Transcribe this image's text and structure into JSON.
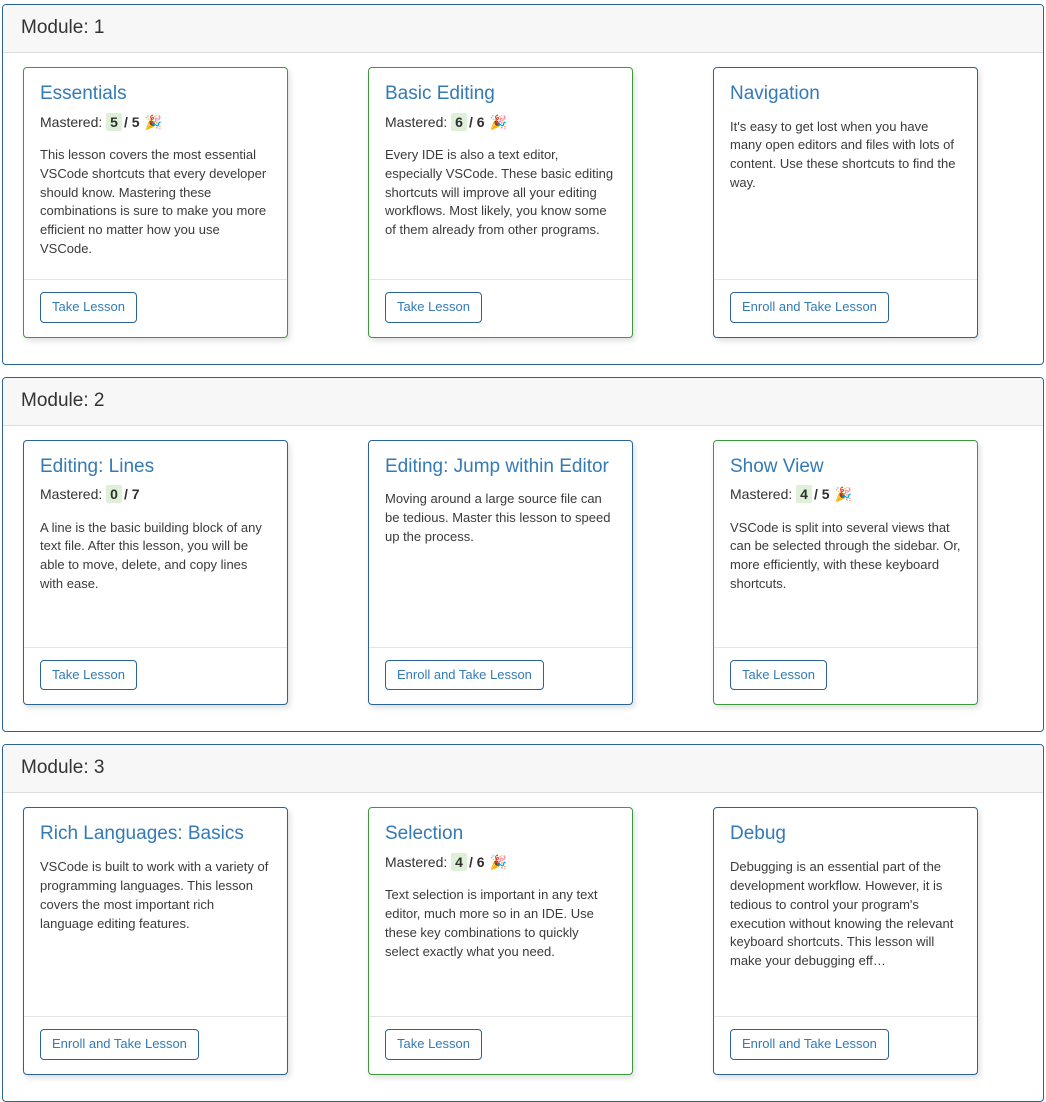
{
  "colors": {
    "panel_border": "#2a6496",
    "panel_header_bg": "#f7f7f7",
    "title_blue": "#337ab7",
    "mastered_border_green": "#3c9a3c",
    "mastered_badge_bg": "#dff0d8"
  },
  "labels": {
    "mastered_prefix": "Mastered:",
    "separator": "/",
    "party_icon": "🎉",
    "take_lesson": "Take Lesson",
    "enroll_and_take_lesson": "Enroll and Take Lesson"
  },
  "modules": [
    {
      "header": "Module: 1",
      "cards": [
        {
          "title": "Essentials",
          "mastered": true,
          "mastered_count": "5",
          "mastered_total": "5",
          "description": "This lesson covers the most essential VSCode shortcuts that every developer should know. Mastering these combinations is sure to make you more efficient no matter how you use VSCode.",
          "button": "Take Lesson",
          "enrolled": true
        },
        {
          "title": "Basic Editing",
          "mastered": true,
          "mastered_count": "6",
          "mastered_total": "6",
          "description": "Every IDE is also a text editor, especially VSCode. These basic editing shortcuts will improve all your editing workflows. Most likely, you know some of them already from other programs.",
          "button": "Take Lesson",
          "enrolled": true
        },
        {
          "title": "Navigation",
          "mastered": false,
          "mastered_count": "",
          "mastered_total": "",
          "description": "It's easy to get lost when you have many open editors and files with lots of content. Use these shortcuts to find the way.",
          "button": "Enroll and Take Lesson",
          "enrolled": false
        }
      ]
    },
    {
      "header": "Module: 2",
      "cards": [
        {
          "title": "Editing: Lines",
          "mastered": false,
          "mastered_count": "0",
          "mastered_total": "7",
          "description": "A line is the basic building block of any text file. After this lesson, you will be able to move, delete, and copy lines with ease.",
          "button": "Take Lesson",
          "enrolled": true
        },
        {
          "title": "Editing: Jump within Editor",
          "mastered": false,
          "mastered_count": "",
          "mastered_total": "",
          "description": "Moving around a large source file can be tedious. Master this lesson to speed up the process.",
          "button": "Enroll and Take Lesson",
          "enrolled": false
        },
        {
          "title": "Show View",
          "mastered": true,
          "mastered_count": "4",
          "mastered_total": "5",
          "description": "VSCode is split into several views that can be selected through the sidebar. Or, more efficiently, with these keyboard shortcuts.",
          "button": "Take Lesson",
          "enrolled": true
        }
      ]
    },
    {
      "header": "Module: 3",
      "cards": [
        {
          "title": "Rich Languages: Basics",
          "mastered": false,
          "mastered_count": "",
          "mastered_total": "",
          "description": "VSCode is built to work with a variety of programming languages. This lesson covers the most important rich language editing features.",
          "button": "Enroll and Take Lesson",
          "enrolled": false
        },
        {
          "title": "Selection",
          "mastered": true,
          "mastered_count": "4",
          "mastered_total": "6",
          "description": "Text selection is important in any text editor, much more so in an IDE. Use these key combinations to quickly select exactly what you need.",
          "button": "Take Lesson",
          "enrolled": true
        },
        {
          "title": "Debug",
          "mastered": false,
          "mastered_count": "",
          "mastered_total": "",
          "description": "Debugging is an essential part of the development workflow. However, it is tedious to control your program's execution without knowing the relevant keyboard shortcuts. This lesson will make your debugging eff…",
          "button": "Enroll and Take Lesson",
          "enrolled": false
        }
      ]
    }
  ]
}
